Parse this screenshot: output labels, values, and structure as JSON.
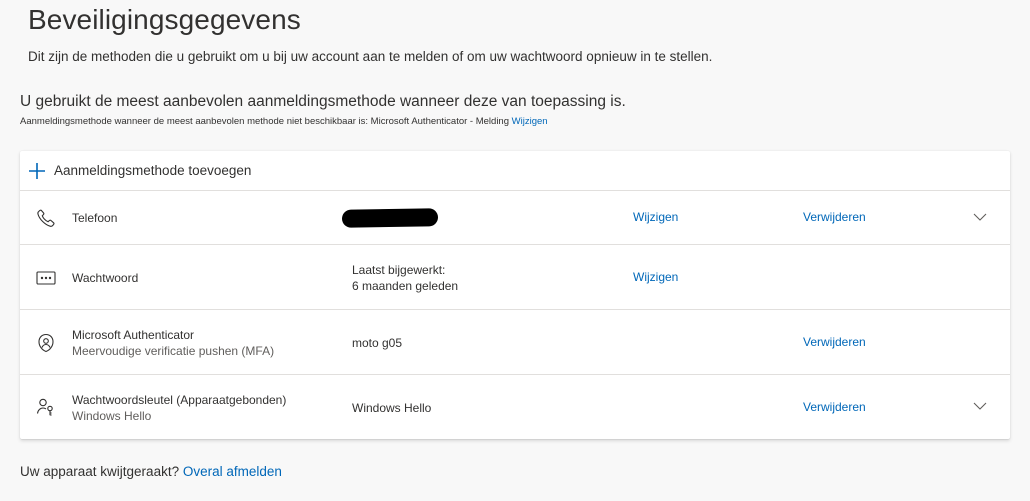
{
  "page": {
    "title": "Beveiligingsgegevens",
    "description": "Dit zijn de methoden die u gebruikt om u bij uw account aan te melden of om uw wachtwoord opnieuw in te stellen.",
    "default_heading": "U gebruikt de meest aanbevolen aanmeldingsmethode wanneer deze van toepassing is.",
    "default_note": "Aanmeldingsmethode wanneer de meest aanbevolen methode niet beschikbaar is: Microsoft Authenticator - Melding",
    "default_note_link": "Wijzigen"
  },
  "card": {
    "add_label": "Aanmeldingsmethode toevoegen",
    "methods": [
      {
        "icon": "phone-icon",
        "name": "Telefoon",
        "detail_redacted": true,
        "edit_label": "Wijzigen",
        "remove_label": "Verwijderen",
        "expandable": true
      },
      {
        "icon": "password-icon",
        "name": "Wachtwoord",
        "detail_line1": "Laatst bijgewerkt:",
        "detail_line2": "6 maanden geleden",
        "edit_label": "Wijzigen"
      },
      {
        "icon": "authenticator-icon",
        "name": "Microsoft Authenticator",
        "sub": "Meervoudige verificatie pushen (MFA)",
        "detail": "moto g05",
        "remove_label": "Verwijderen"
      },
      {
        "icon": "passkey-icon",
        "name": "Wachtwoordsleutel (Apparaatgebonden)",
        "sub": "Windows Hello",
        "detail": "Windows Hello",
        "remove_label": "Verwijderen",
        "expandable": true
      }
    ]
  },
  "footer": {
    "question": "Uw apparaat kwijtgeraakt?",
    "link": "Overal afmelden"
  },
  "colors": {
    "link": "#0067b8",
    "background": "#f8f8f8",
    "text": "#323130"
  }
}
